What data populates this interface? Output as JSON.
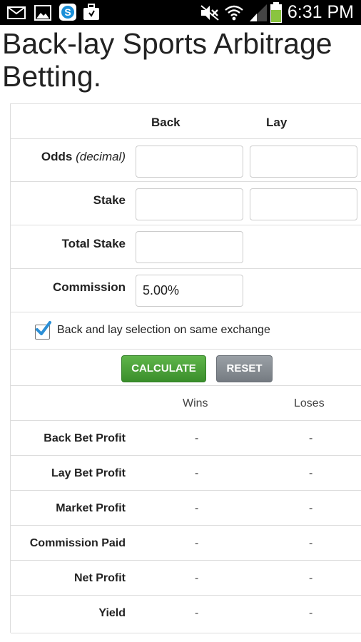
{
  "status_bar": {
    "time": "6:31 PM",
    "left_icons": [
      "mail-icon",
      "image-icon",
      "skype-icon",
      "briefcase-icon"
    ],
    "right_icons": [
      "mute-icon",
      "wifi-icon",
      "signal-icon",
      "battery-icon"
    ]
  },
  "page": {
    "title": "Back-lay Sports Arbitrage Betting."
  },
  "form": {
    "col_back": "Back",
    "col_lay": "Lay",
    "odds_label": "Odds",
    "odds_hint": "(decimal)",
    "stake_label": "Stake",
    "total_stake_label": "Total Stake",
    "commission_label": "Commission",
    "commission_value": "5.00%",
    "same_exchange_label": "Back and lay selection on same exchange",
    "same_exchange_checked": true,
    "calculate_label": "CALCULATE",
    "reset_label": "RESET"
  },
  "results": {
    "col_wins": "Wins",
    "col_loses": "Loses",
    "rows": [
      {
        "label": "Back Bet Profit",
        "wins": "-",
        "loses": "-"
      },
      {
        "label": "Lay Bet Profit",
        "wins": "-",
        "loses": "-"
      },
      {
        "label": "Market Profit",
        "wins": "-",
        "loses": "-"
      },
      {
        "label": "Commission Paid",
        "wins": "-",
        "loses": "-"
      },
      {
        "label": "Net Profit",
        "wins": "-",
        "loses": "-"
      },
      {
        "label": "Yield",
        "wins": "-",
        "loses": "-"
      }
    ]
  },
  "colors": {
    "calculate_button": "#4a9e39",
    "reset_button": "#858b91",
    "checkbox_check": "#2b8fd6",
    "battery": "#8ac43f"
  }
}
